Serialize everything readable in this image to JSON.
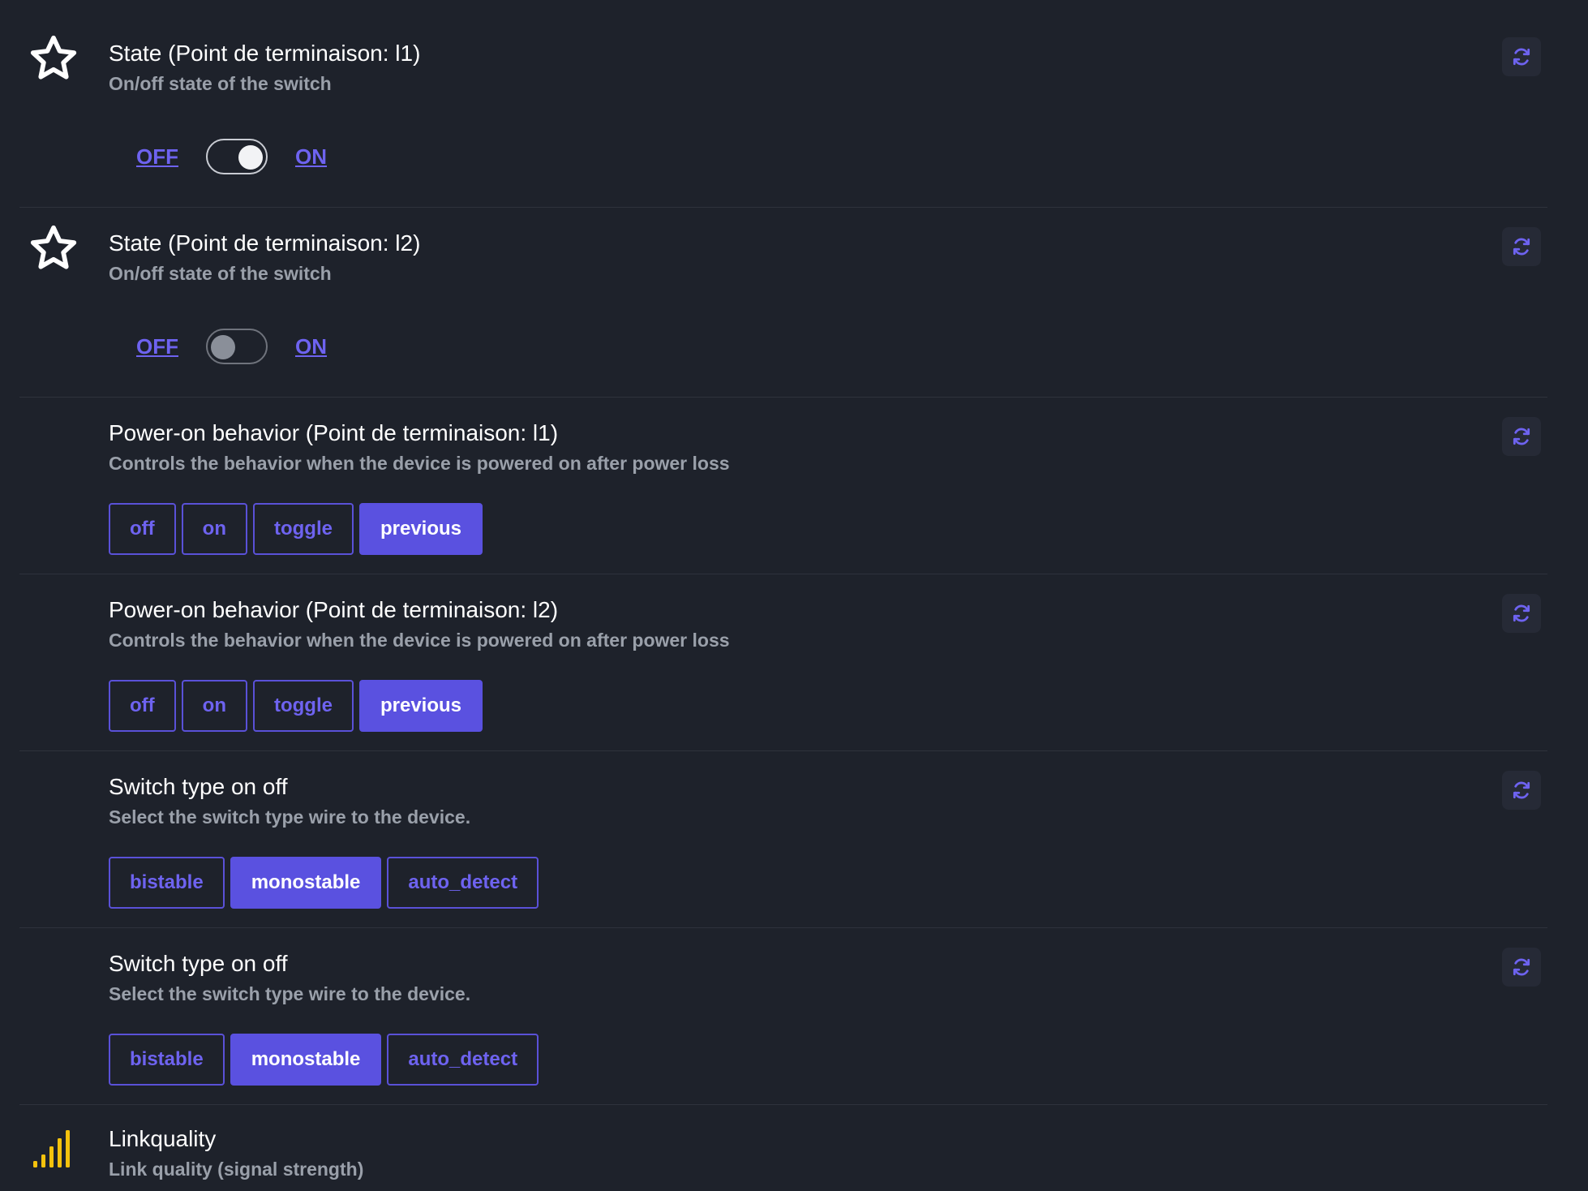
{
  "accent_color": "#5a51e0",
  "link_color": "#6e63f0",
  "rows": [
    {
      "title": "State (Point de terminaison: l1)",
      "description": "On/off state of the switch",
      "icon": "star-icon",
      "off_label": "OFF",
      "on_label": "ON",
      "state": "ON"
    },
    {
      "title": "State (Point de terminaison: l2)",
      "description": "On/off state of the switch",
      "icon": "star-icon",
      "off_label": "OFF",
      "on_label": "ON",
      "state": "OFF"
    },
    {
      "title": "Power-on behavior (Point de terminaison: l1)",
      "description": "Controls the behavior when the device is powered on after power loss",
      "options": [
        "off",
        "on",
        "toggle",
        "previous"
      ],
      "selected": "previous"
    },
    {
      "title": "Power-on behavior (Point de terminaison: l2)",
      "description": "Controls the behavior when the device is powered on after power loss",
      "options": [
        "off",
        "on",
        "toggle",
        "previous"
      ],
      "selected": "previous"
    },
    {
      "title": "Switch type on off",
      "description": "Select the switch type wire to the device.",
      "options": [
        "bistable",
        "monostable",
        "auto_detect"
      ],
      "selected": "monostable"
    },
    {
      "title": "Switch type on off",
      "description": "Select the switch type wire to the device.",
      "options": [
        "bistable",
        "monostable",
        "auto_detect"
      ],
      "selected": "monostable"
    },
    {
      "title": "Linkquality",
      "description": "Link quality (signal strength)",
      "icon": "signal-bars-icon"
    }
  ]
}
